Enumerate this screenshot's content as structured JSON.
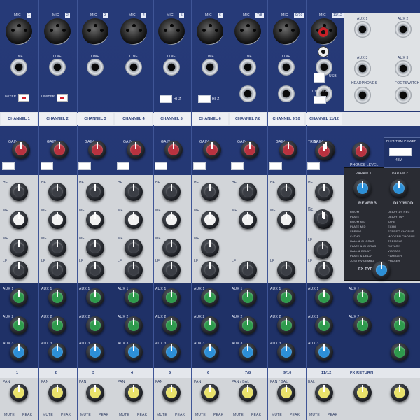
{
  "channels": [
    {
      "num": "1",
      "label": "CHANNEL 1",
      "bottom": "1"
    },
    {
      "num": "2",
      "label": "CHANNEL 2",
      "bottom": "2"
    },
    {
      "num": "3",
      "label": "CHANNEL 3",
      "bottom": "3"
    },
    {
      "num": "4",
      "label": "CHANNEL 4",
      "bottom": "4"
    },
    {
      "num": "5",
      "label": "CHANNEL 5",
      "bottom": "5"
    },
    {
      "num": "6",
      "label": "CHANNEL 6",
      "bottom": "6"
    },
    {
      "num": "7/8",
      "label": "CHANNEL 7/8",
      "bottom": "7/8"
    },
    {
      "num": "9/10",
      "label": "CHANNEL 9/10",
      "bottom": "9/10"
    },
    {
      "num": "11/12",
      "label": "CHANNEL 11/12",
      "bottom": "11/12"
    }
  ],
  "labels": {
    "mic": "MIC",
    "line": "LINE",
    "limiter": "LIMITER",
    "gain": "GAIN",
    "hf": "HF",
    "mf": "MF",
    "lf": "LF",
    "aux1": "AUX 1",
    "aux2": "AUX 2",
    "aux3": "AUX 3",
    "pan": "PAN",
    "pan_bal": "PAN / BAL",
    "bal": "BAL",
    "mute": "MUTE",
    "peak": "PEAK",
    "hz": "HI-Z",
    "usb": "USB",
    "usb_send": "USB SEND",
    "trim": "TRIM",
    "phones_level": "PHONES LEVEL",
    "phantom": "PHANTOM POWER",
    "phantom_v": "48V",
    "fx_return": "FX RETURN",
    "fx_type": "FX TYPE",
    "headphones": "HEADPHONES",
    "footswitch": "FOOTSWITCH"
  },
  "fx": {
    "param1": "PARAM 1",
    "param2": "PARAM 2",
    "col1_title": "REVERB",
    "col2_title": "DLY/MOD",
    "col1_items": [
      "ROOM",
      "PLATE",
      "ROOM MID",
      "PLATE MID",
      "SPRING",
      "CATHD",
      "HALL & CHORUS",
      "PLATE & CHORUS",
      "HALL & DELAY",
      "PLATE & DELAY",
      "JUST RVB/EMBD"
    ],
    "col2_items": [
      "DELAY 1/4 REC",
      "DELAY TAP",
      "TAPE",
      "ECHO",
      "STEREO CHORUS",
      "MODERN CHORUS",
      "TREMOLO",
      "ROTARY",
      "VIBRATO",
      "FLANGER",
      "PHASER"
    ]
  },
  "colors": {
    "gain_knob": "#b8323f",
    "eq_knob": "#3b3e45",
    "mf_knob": "#f2f2f2",
    "aux_knob": "#2e9a4c",
    "aux3_knob": "#2c8fd6",
    "pan_knob": "#e9e26a"
  }
}
